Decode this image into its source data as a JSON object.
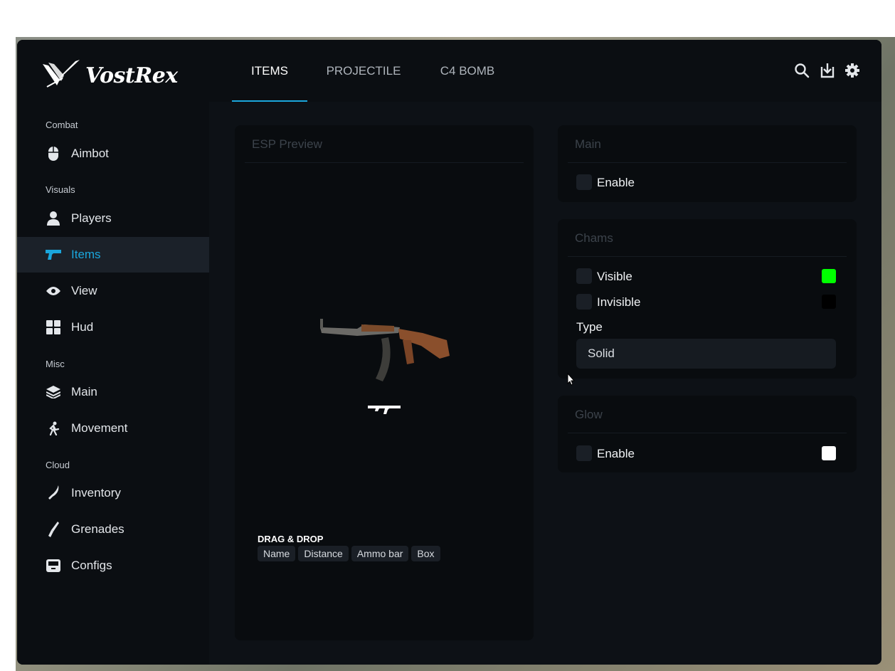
{
  "brand": {
    "name": "VostRex",
    "logo_icon": "wing-logo-icon"
  },
  "sidebar": {
    "sections": [
      {
        "label": "Combat"
      },
      {
        "label": "Visuals"
      },
      {
        "label": "Misc"
      },
      {
        "label": "Cloud"
      }
    ],
    "items": [
      {
        "label": "Aimbot",
        "icon": "mouse-icon"
      },
      {
        "label": "Players",
        "icon": "user-icon"
      },
      {
        "label": "Items",
        "icon": "gun-icon",
        "active": true
      },
      {
        "label": "View",
        "icon": "eye-icon"
      },
      {
        "label": "Hud",
        "icon": "grid-icon"
      },
      {
        "label": "Main",
        "icon": "layers-icon"
      },
      {
        "label": "Movement",
        "icon": "running-icon"
      },
      {
        "label": "Inventory",
        "icon": "knife-icon"
      },
      {
        "label": "Grenades",
        "icon": "blade-icon"
      },
      {
        "label": "Configs",
        "icon": "archive-icon"
      }
    ]
  },
  "tabs": [
    {
      "label": "ITEMS",
      "active": true
    },
    {
      "label": "PROJECTILE"
    },
    {
      "label": "C4 BOMB"
    }
  ],
  "toolbar": {
    "icons": [
      "search-icon",
      "download-icon",
      "gear-icon"
    ]
  },
  "preview": {
    "title": "ESP Preview",
    "drag_label": "DRAG & DROP",
    "chips": [
      "Name",
      "Distance",
      "Ammo bar",
      "Box"
    ]
  },
  "main_panel": {
    "title": "Main",
    "enable_label": "Enable"
  },
  "chams_panel": {
    "title": "Chams",
    "visible_label": "Visible",
    "visible_color": "#00ff00",
    "invisible_label": "Invisible",
    "invisible_color": "#000000",
    "type_label": "Type",
    "type_value": "Solid"
  },
  "glow_panel": {
    "title": "Glow",
    "enable_label": "Enable",
    "color": "#ffffff"
  },
  "colors": {
    "accent": "#1aa6dc"
  }
}
